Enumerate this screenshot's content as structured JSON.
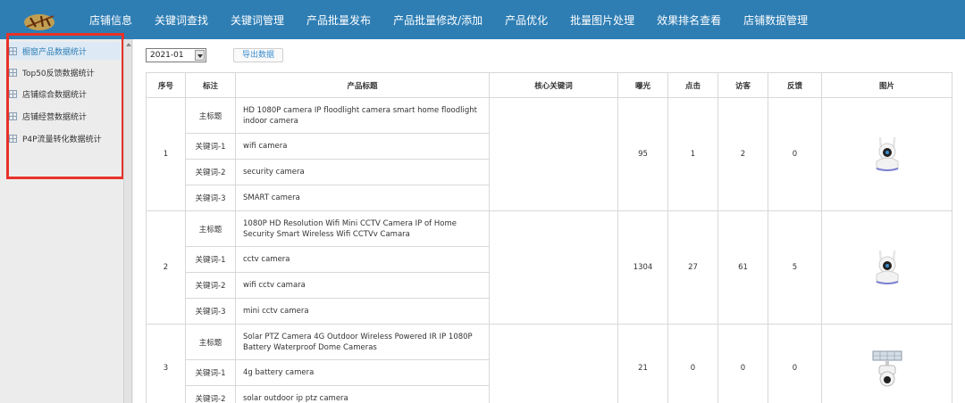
{
  "app": {
    "logo_text": "御剑",
    "colors": {
      "header": "#2e7eb4",
      "accent": "#2e7eb4",
      "highlight": "#e8322a"
    }
  },
  "nav": {
    "items": [
      "店铺信息",
      "关键词查找",
      "关键词管理",
      "产品批量发布",
      "产品批量修改/添加",
      "产品优化",
      "批量图片处理",
      "效果排名查看",
      "店铺数据管理"
    ]
  },
  "sidebar": {
    "items": [
      {
        "label": "橱窗产品数据统计",
        "icon": "grid-icon",
        "active": true
      },
      {
        "label": "Top50反馈数据统计",
        "icon": "grid-icon"
      },
      {
        "label": "店铺综合数据统计",
        "icon": "grid-icon"
      },
      {
        "label": "店铺经营数据统计",
        "icon": "grid-icon"
      },
      {
        "label": "P4P流量转化数据统计",
        "icon": "grid-icon"
      }
    ]
  },
  "toolbar": {
    "month_value": "2021-01",
    "export_label": "导出数据"
  },
  "table": {
    "headers": [
      "序号",
      "标注",
      "产品标题",
      "核心关键词",
      "曝光",
      "点击",
      "访客",
      "反馈",
      "图片"
    ],
    "rows": [
      {
        "index": "1",
        "main_label": "主标题",
        "main_title": "HD 1080P camera IP floodlight camera smart home floodlight indoor camera",
        "keywords": [
          {
            "label": "关键词-1",
            "value": "wifi camera"
          },
          {
            "label": "关键词-2",
            "value": "security camera"
          },
          {
            "label": "关键词-3",
            "value": "SMART camera"
          }
        ],
        "core_keyword": "",
        "exposure": "95",
        "clicks": "1",
        "visitors": "2",
        "feedback": "0",
        "image": "dome-camera-image"
      },
      {
        "index": "2",
        "main_label": "主标题",
        "main_title": "1080P HD Resolution Wifi Mini CCTV Camera IP of Home Security Smart Wireless Wifi CCTVv Camara",
        "keywords": [
          {
            "label": "关键词-1",
            "value": "cctv camera"
          },
          {
            "label": "关键词-2",
            "value": "wifi cctv camara"
          },
          {
            "label": "关键词-3",
            "value": "mini cctv camera"
          }
        ],
        "core_keyword": "",
        "exposure": "1304",
        "clicks": "27",
        "visitors": "61",
        "feedback": "5",
        "image": "dome-camera-image"
      },
      {
        "index": "3",
        "main_label": "主标题",
        "main_title": "Solar PTZ Camera 4G Outdoor Wireless Powered IR IP 1080P Battery Waterproof Dome Cameras",
        "keywords": [
          {
            "label": "关键词-1",
            "value": "4g battery camera"
          },
          {
            "label": "关键词-2",
            "value": "solar outdoor ip ptz camera"
          }
        ],
        "core_keyword": "",
        "exposure": "21",
        "clicks": "0",
        "visitors": "0",
        "feedback": "0",
        "image": "solar-camera-image"
      }
    ]
  }
}
